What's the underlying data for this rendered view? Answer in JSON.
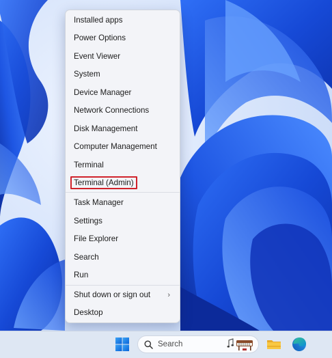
{
  "menu": {
    "items": [
      {
        "label": "Installed apps"
      },
      {
        "label": "Power Options"
      },
      {
        "label": "Event Viewer"
      },
      {
        "label": "System"
      },
      {
        "label": "Device Manager"
      },
      {
        "label": "Network Connections"
      },
      {
        "label": "Disk Management"
      },
      {
        "label": "Computer Management"
      },
      {
        "label": "Terminal"
      },
      {
        "label": "Terminal (Admin)"
      },
      {
        "label": "Task Manager"
      },
      {
        "label": "Settings"
      },
      {
        "label": "File Explorer"
      },
      {
        "label": "Search"
      },
      {
        "label": "Run"
      },
      {
        "label": "Shut down or sign out"
      },
      {
        "label": "Desktop"
      }
    ],
    "submenu_chevron": "›",
    "highlight_color": "#d0222b"
  },
  "taskbar": {
    "search_placeholder": "Search",
    "icons": [
      "windows-logo-icon",
      "search-icon",
      "file-explorer-icon",
      "edge-icon"
    ]
  },
  "colors": {
    "wallpaper_blue": "#1c55e6",
    "menu_background": "#f3f4f8",
    "taskbar_background": "#dee7f3"
  }
}
